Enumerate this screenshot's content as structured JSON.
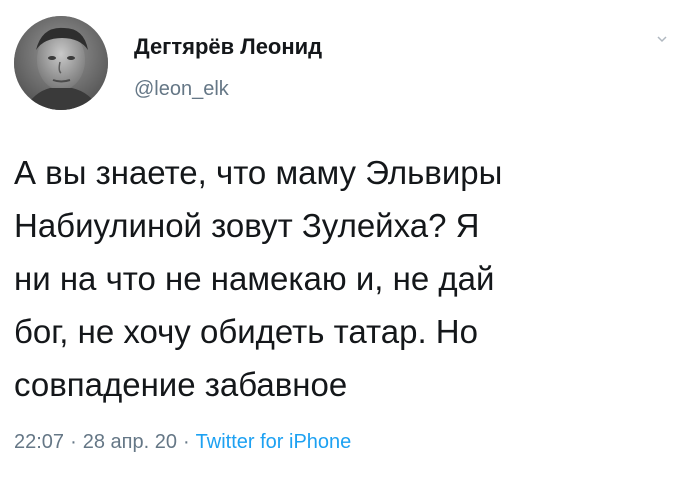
{
  "author": {
    "display_name": "Дегтярёв Леонид",
    "handle": "@leon_elk",
    "avatar_icon": "user-avatar"
  },
  "tweet": {
    "lines": [
      "А вы знаете, что маму Эльвиры",
      "Набиулиной зовут Зулейха? Я",
      "ни на что не намекаю и, не дай",
      "бог, не хочу обидеть татар. Но",
      "совпадение забавное"
    ]
  },
  "meta": {
    "time": "22:07",
    "separator": "·",
    "date": "28 апр. 20",
    "source": "Twitter for iPhone"
  },
  "colors": {
    "text": "#14171a",
    "secondary": "#657786",
    "link": "#1da1f2"
  },
  "icons": {
    "more": "chevron-down-icon"
  }
}
